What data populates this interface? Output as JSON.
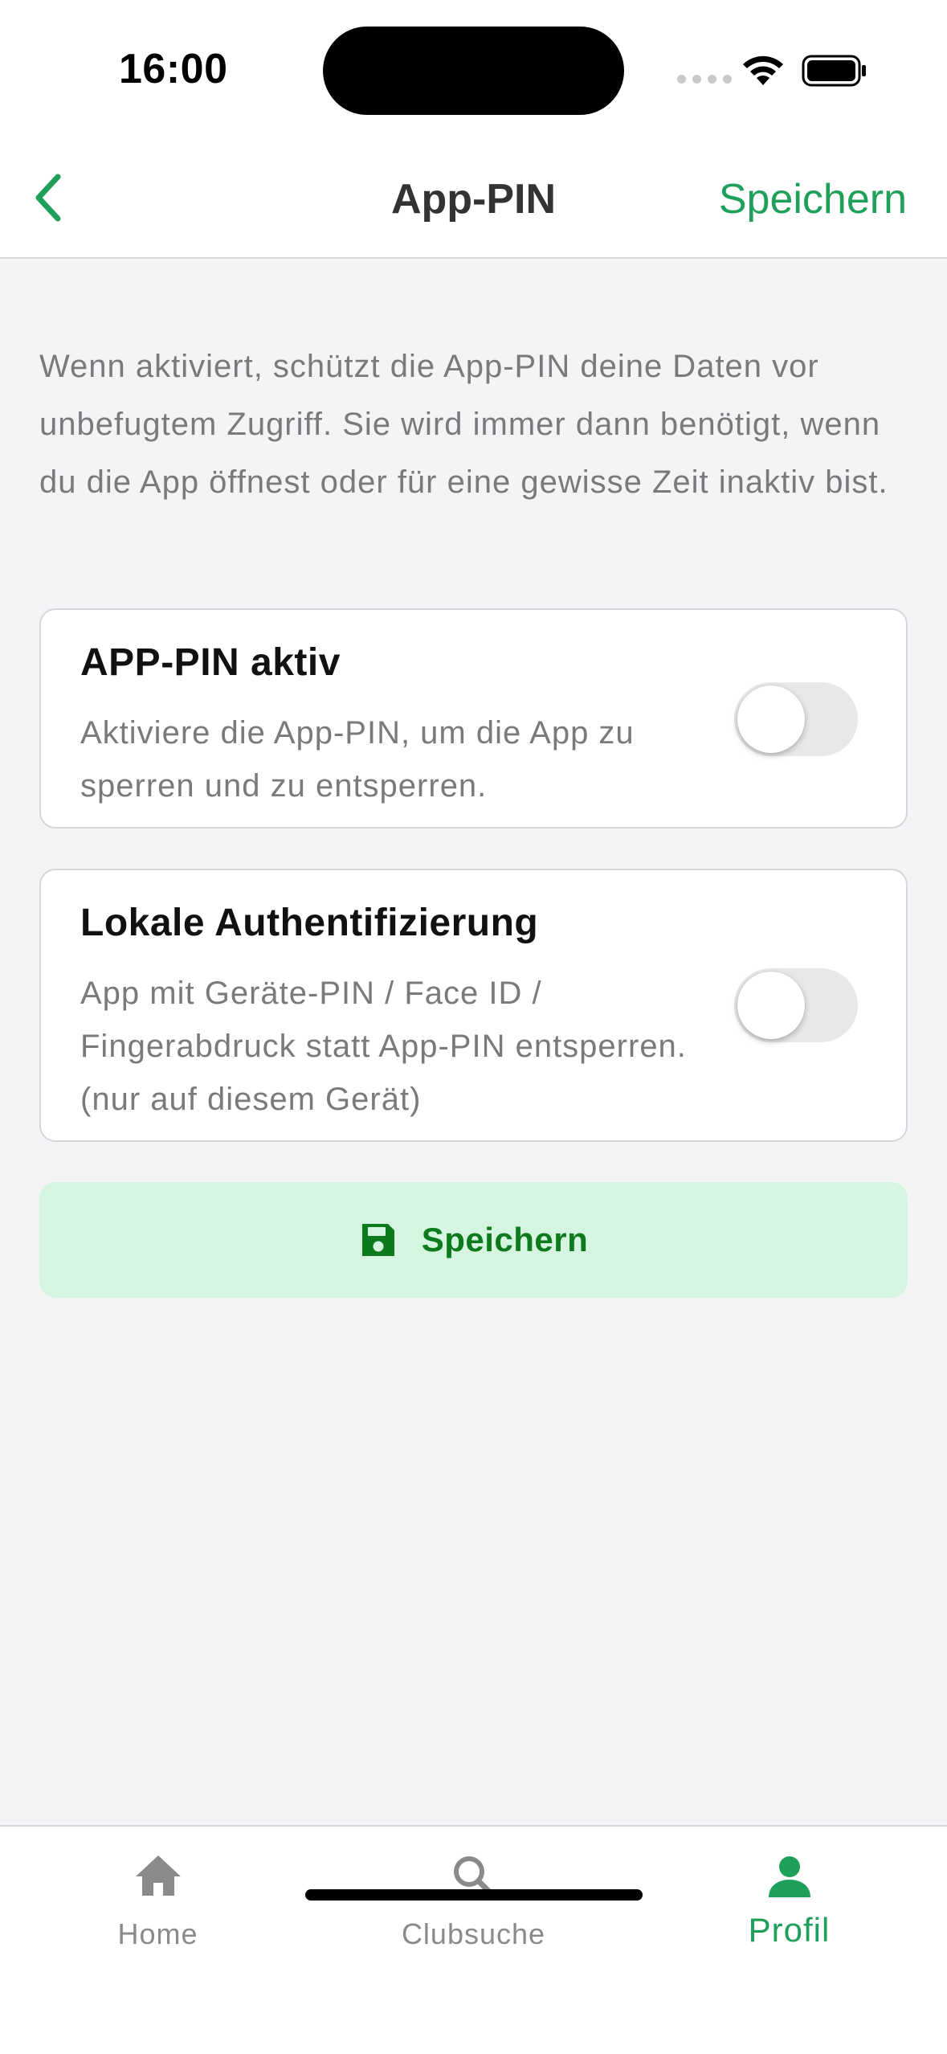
{
  "status_bar": {
    "time": "16:00"
  },
  "nav": {
    "title": "App-PIN",
    "save_label": "Speichern"
  },
  "description": "Wenn aktiviert, schützt die App-PIN deine Daten vor unbefugtem Zugriff. Sie wird immer dann benötigt, wenn du die App öffnest oder für eine gewisse Zeit inaktiv bist.",
  "settings": [
    {
      "title": "APP-PIN aktiv",
      "description": "Aktiviere die App-PIN, um die App zu sperren und zu entsperren.",
      "enabled": false
    },
    {
      "title": "Lokale Authentifizierung",
      "description": "App mit Geräte-PIN / Face ID / Fingerabdruck statt App-PIN entsperren. (nur auf diesem Gerät)",
      "enabled": false
    }
  ],
  "save_button": {
    "label": "Speichern",
    "icon": "floppy-disk-icon"
  },
  "tab_bar": {
    "tabs": [
      {
        "label": "Home",
        "icon": "home-icon",
        "active": false
      },
      {
        "label": "Clubsuche",
        "icon": "search-icon",
        "active": false
      },
      {
        "label": "Profil",
        "icon": "person-icon",
        "active": true
      }
    ]
  },
  "colors": {
    "accent": "#1fa05a",
    "save_button_bg": "#d5f5e1",
    "save_button_text": "#0d7a1e",
    "background": "#f4f4f6"
  }
}
